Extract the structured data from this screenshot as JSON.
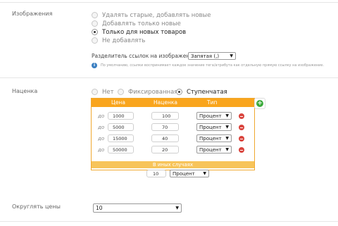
{
  "images_section": {
    "label": "Изображения",
    "options": [
      "Удалять старые, добавлять новые",
      "Добавлять только новые",
      "Только для новых товаров",
      "Не добавлять"
    ],
    "selected_index": 2,
    "separator_label": "Разделитель ссылок на изображения:",
    "separator_value": "Запятая (,)",
    "hint": "По умолчанию, ссылки воспринимает каждое значение тега/атрибута как отдельную прямую ссылку на изображение."
  },
  "markup_section": {
    "label": "Наценка",
    "options": [
      "Нет",
      "Фиксированная",
      "Ступенчатая"
    ],
    "selected_index": 2,
    "table": {
      "headers": [
        "Цена",
        "Наценка",
        "Тип"
      ],
      "prefix": "до",
      "rows": [
        {
          "price": "1000",
          "markup": "100",
          "type": "Процент"
        },
        {
          "price": "5000",
          "markup": "70",
          "type": "Процент"
        },
        {
          "price": "15000",
          "markup": "40",
          "type": "Процент"
        },
        {
          "price": "50000",
          "markup": "20",
          "type": "Процент"
        }
      ],
      "other_label": "В иных случаях",
      "other_markup": "10",
      "other_type": "Процент"
    }
  },
  "rounding_section": {
    "label": "Округлять цены",
    "value": "10"
  },
  "icons": {
    "delete": "minus-circle-icon",
    "add": "plus-circle-icon",
    "info": "info-icon",
    "dropdown": "chevron-down-icon"
  },
  "colors": {
    "header_orange": "#f9a51d",
    "other_row": "#f7c45a",
    "delete_red": "#d9433c",
    "add_green": "#3caa3c",
    "info_blue": "#3a7fc1"
  }
}
